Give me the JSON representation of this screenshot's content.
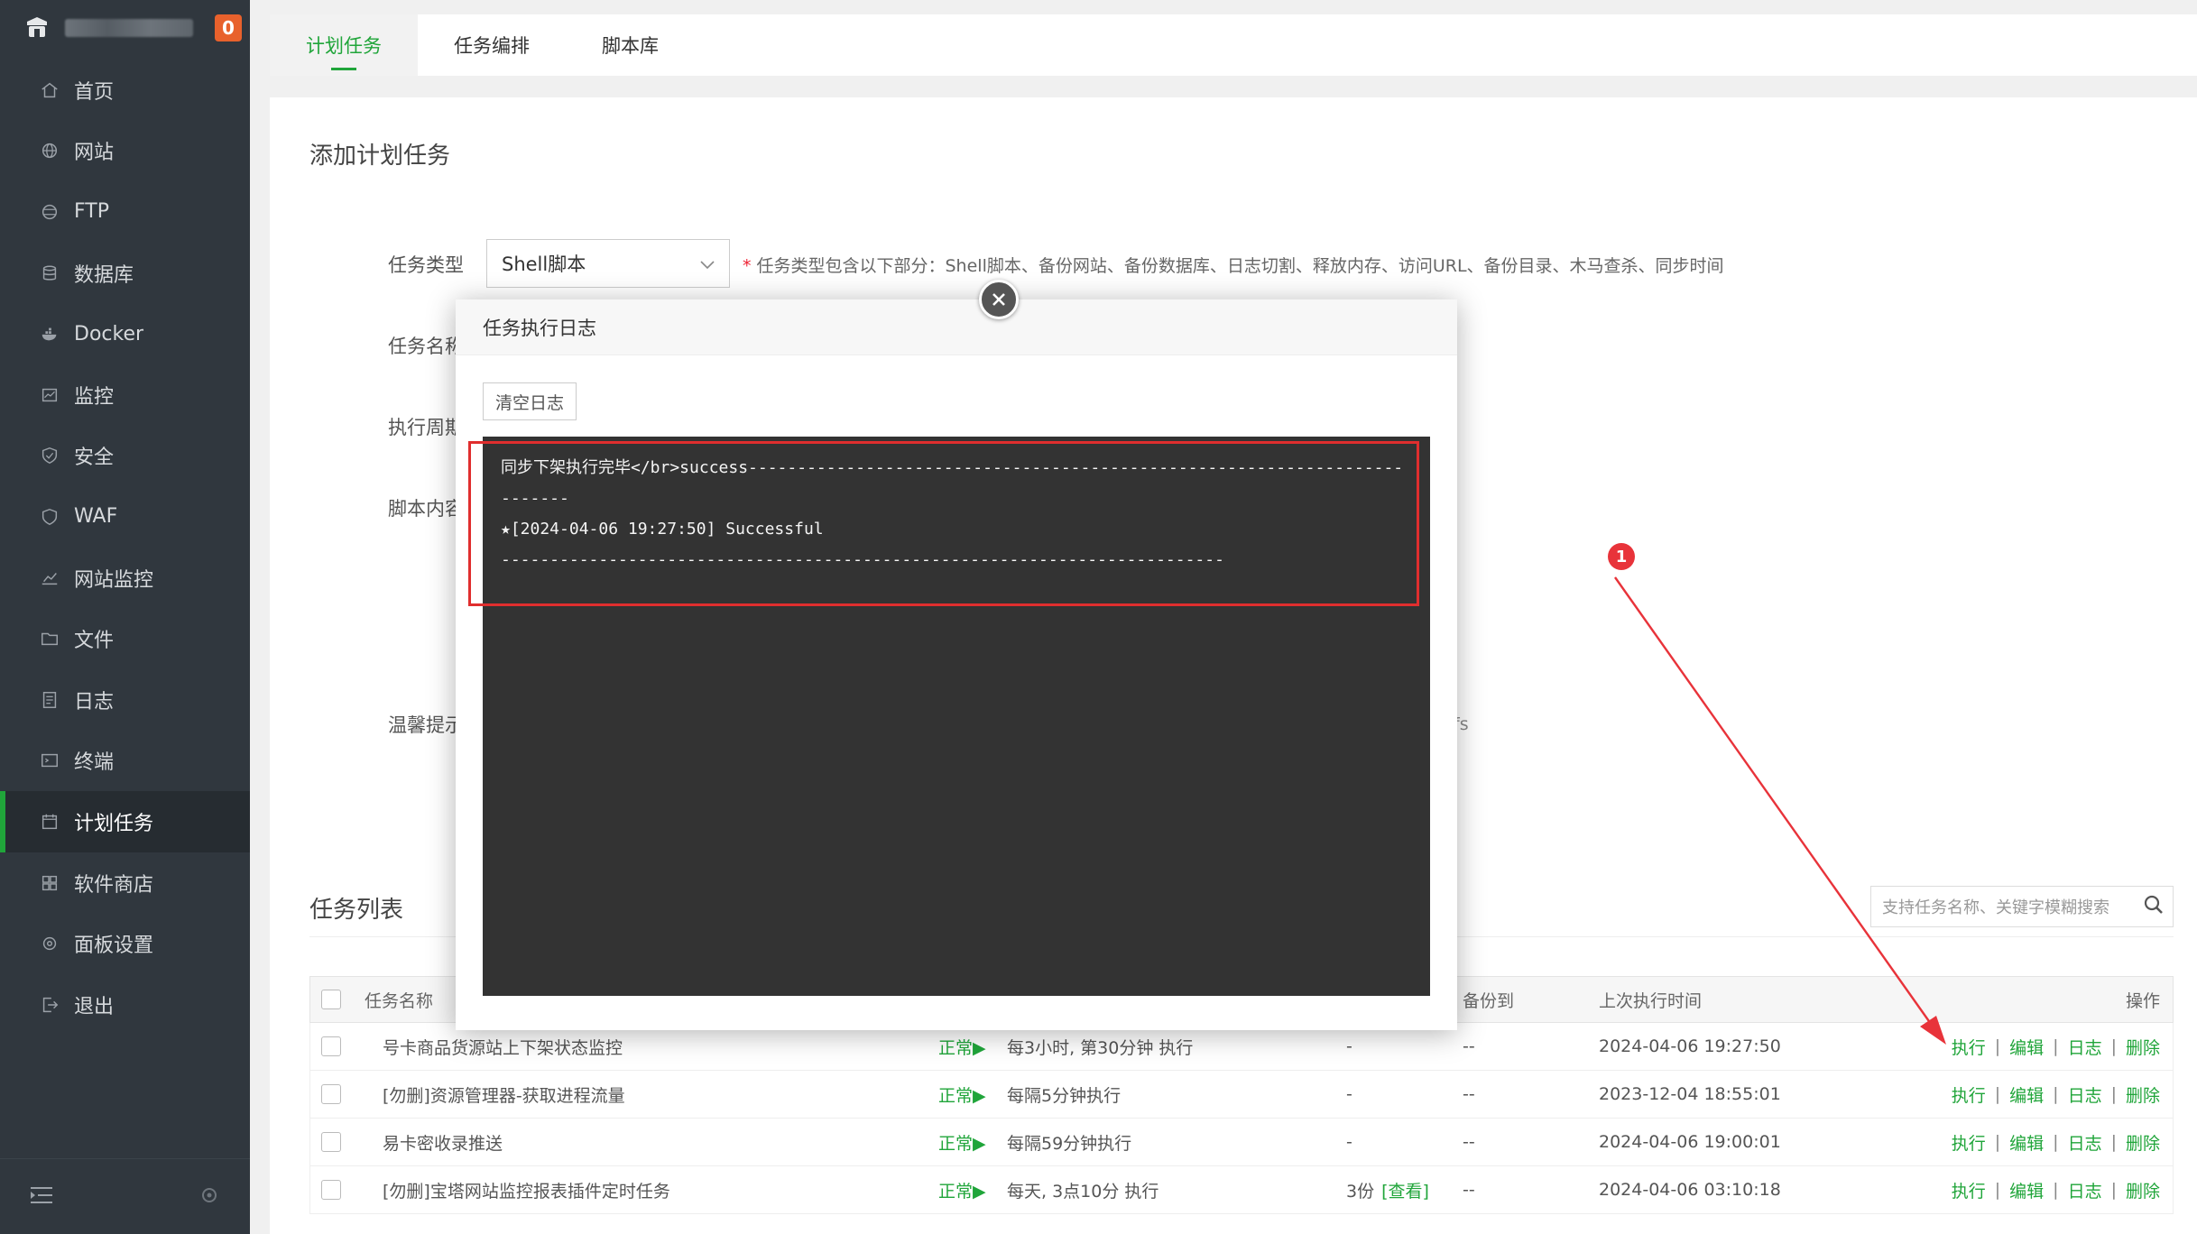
{
  "sidebar": {
    "alert_count": "0",
    "items": [
      {
        "label": "首页",
        "icon": "home-icon"
      },
      {
        "label": "网站",
        "icon": "globe-icon"
      },
      {
        "label": "FTP",
        "icon": "ftp-icon"
      },
      {
        "label": "数据库",
        "icon": "database-icon"
      },
      {
        "label": "Docker",
        "icon": "docker-icon"
      },
      {
        "label": "监控",
        "icon": "monitor-icon"
      },
      {
        "label": "安全",
        "icon": "shield-icon"
      },
      {
        "label": "WAF",
        "icon": "waf-icon"
      },
      {
        "label": "网站监控",
        "icon": "chart-icon"
      },
      {
        "label": "文件",
        "icon": "folder-icon"
      },
      {
        "label": "日志",
        "icon": "log-icon"
      },
      {
        "label": "终端",
        "icon": "terminal-icon"
      },
      {
        "label": "计划任务",
        "icon": "calendar-icon"
      },
      {
        "label": "软件商店",
        "icon": "grid-icon"
      },
      {
        "label": "面板设置",
        "icon": "settings-icon"
      },
      {
        "label": "退出",
        "icon": "logout-icon"
      }
    ],
    "active_index": 12
  },
  "tabs": [
    "计划任务",
    "任务编排",
    "脚本库"
  ],
  "form": {
    "title": "添加计划任务",
    "task_type_label": "任务类型",
    "task_type_value": "Shell脚本",
    "task_type_hint": "任务类型包含以下部分：Shell脚本、备份网站、备份数据库、日志切割、释放内存、访问URL、备份目录、木马查杀、同步时间",
    "task_name_label": "任务名称",
    "cycle_label": "执行周期",
    "script_label": "脚本内容",
    "tips_label": "温馨提示",
    "tips_fragment": "fs"
  },
  "task_list": {
    "title": "任务列表",
    "search_placeholder": "支持任务名称、关键字模糊搜索",
    "headers": {
      "name": "任务名称",
      "backup_to": "备份到",
      "last_run": "上次执行时间",
      "actions": "操作"
    },
    "rows": [
      {
        "name": "号卡商品货源站上下架状态监控",
        "status": "正常▶",
        "cycle": "每3小时, 第30分钟 执行",
        "backup": "-",
        "backup_to": "--",
        "last_run": "2024-04-06 19:27:50"
      },
      {
        "name": "[勿删]资源管理器-获取进程流量",
        "status": "正常▶",
        "cycle": "每隔5分钟执行",
        "backup": "-",
        "backup_to": "--",
        "last_run": "2023-12-04 18:55:01"
      },
      {
        "name": "易卡密收录推送",
        "status": "正常▶",
        "cycle": "每隔59分钟执行",
        "backup": "-",
        "backup_to": "--",
        "last_run": "2024-04-06 19:00:01"
      },
      {
        "name": "[勿删]宝塔网站监控报表插件定时任务",
        "status": "正常▶",
        "cycle": "每天, 3点10分 执行",
        "backup": "3份",
        "backup_view": "[查看]",
        "backup_to": "--",
        "last_run": "2024-04-06 03:10:18"
      }
    ],
    "actions": [
      "执行",
      "编辑",
      "日志",
      "删除"
    ]
  },
  "modal": {
    "title": "任务执行日志",
    "clear_button": "清空日志",
    "log_lines": [
      "同步下架执行完毕</br>success--------------------------------------------------------------------------",
      "★[2024-04-06 19:27:50] Successful",
      "--------------------------------------------------------------------------"
    ]
  },
  "annotation": {
    "marker": "1",
    "color": "#e8333a"
  }
}
